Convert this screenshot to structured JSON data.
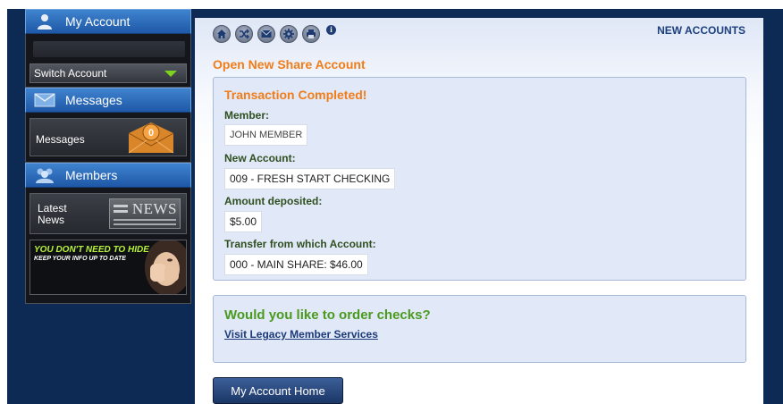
{
  "sidebar": {
    "my_account": {
      "label": "My Account",
      "icon": "user-icon",
      "switch_label": "Switch Account"
    },
    "messages": {
      "label": "Messages",
      "icon": "envelope-icon",
      "tile_label": "Messages",
      "count": "0"
    },
    "members": {
      "label": "Members",
      "icon": "members-icon",
      "news_label_line1": "Latest",
      "news_label_line2": "News",
      "news_graphic_text": "NEWS",
      "promo_line1": "YOU DON'T NEED TO HIDE",
      "promo_line2": "KEEP YOUR INFO UP TO DATE"
    }
  },
  "toolbar": {
    "icons": [
      "home-icon",
      "transfer-icon",
      "mail-icon",
      "settings-icon",
      "print-icon",
      "info-icon"
    ],
    "info_glyph": "i"
  },
  "header": {
    "section_link": "NEW ACCOUNTS",
    "page_title": "Open New Share Account"
  },
  "transaction": {
    "title": "Transaction Completed!",
    "member_label": "Member:",
    "member_value": "JOHN MEMBER",
    "account_label": "New Account:",
    "account_value": "009 - FRESH START CHECKING",
    "amount_label": "Amount deposited:",
    "amount_value": "$5.00",
    "transfer_label": "Transfer from which Account:",
    "transfer_value": "000 - MAIN SHARE: $46.00"
  },
  "checks": {
    "question": "Would you like to order checks?",
    "link": "Visit Legacy Member Services"
  },
  "footer": {
    "home_button": "My Account Home"
  },
  "colors": {
    "accent_orange": "#f07d1a",
    "green": "#4a9a1d",
    "navy": "#0d2a55",
    "sidebar_blue": "#2a6cbc"
  }
}
